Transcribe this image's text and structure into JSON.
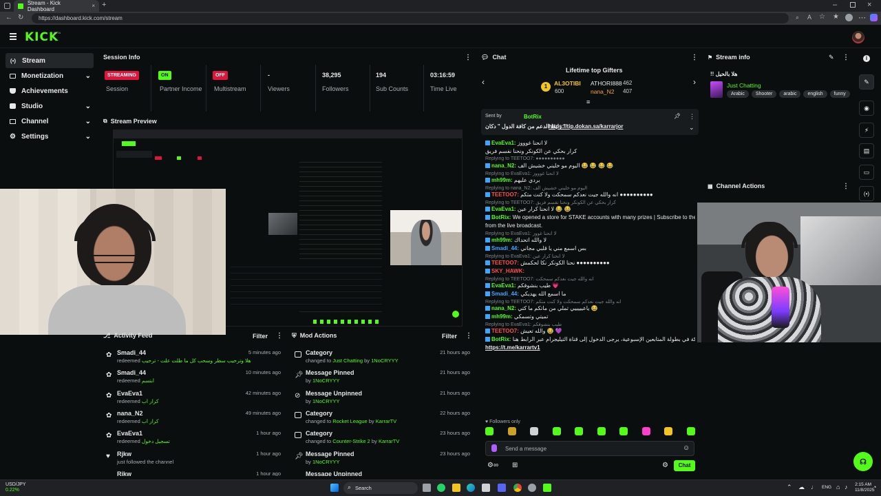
{
  "browser": {
    "tab_title": "Stream - Kick Dashboard",
    "url": "https://dashboard.kick.com/stream"
  },
  "brand": {
    "logo": "KICK",
    "beta": "BETA",
    "accent": "#53fc18"
  },
  "sidebar": {
    "items": [
      {
        "label": "Stream",
        "icon": "broadcast-icon"
      },
      {
        "label": "Monetization",
        "icon": "money-icon"
      },
      {
        "label": "Achievements",
        "icon": "trophy-icon"
      },
      {
        "label": "Studio",
        "icon": "studio-icon"
      },
      {
        "label": "Channel",
        "icon": "channel-icon"
      },
      {
        "label": "Settings",
        "icon": "gear-icon"
      }
    ]
  },
  "session": {
    "title": "Session Info",
    "stats": [
      {
        "badge": "STREAMING",
        "label": "Session"
      },
      {
        "badge": "ON",
        "label": "Partner Income"
      },
      {
        "badge": "OFF",
        "label": "Multistream"
      },
      {
        "value": "-",
        "label": "Viewers"
      },
      {
        "value": "38,295",
        "label": "Followers"
      },
      {
        "value": "194",
        "label": "Sub Counts"
      },
      {
        "value": "03:16:59",
        "label": "Time Live"
      }
    ]
  },
  "preview": {
    "title": "Stream Preview"
  },
  "activity": {
    "title": "Activity Feed",
    "filter": "Filter",
    "items": [
      {
        "name": "Smadi_44",
        "action": "redeemed",
        "reward": "هلا وترحيب سطر وسحب كل ما طلت علت - ترحيب",
        "time": "5 minutes ago"
      },
      {
        "name": "Smadi_44",
        "action": "redeemed",
        "reward": "ابتسم",
        "time": "10 minutes ago"
      },
      {
        "name": "EvaEva1",
        "action": "redeemed",
        "reward": "كرار اب",
        "time": "42 minutes ago"
      },
      {
        "name": "nana_N2",
        "action": "redeemed",
        "reward": "كرار اب",
        "time": "49 minutes ago"
      },
      {
        "name": "EvaEva1",
        "action": "redeemed",
        "reward": "تسجيل دخول",
        "time": "1 hour ago"
      },
      {
        "name": "Rjkw",
        "action": "just followed the channel",
        "reward": "",
        "time": "1 hour ago"
      },
      {
        "name": "Rjkw",
        "action": "",
        "reward": "",
        "time": "1 hour ago"
      }
    ]
  },
  "mod": {
    "title": "Mod Actions",
    "filter": "Filter",
    "items": [
      {
        "title": "Category",
        "prefix": "changed to",
        "target": "Just Chatting",
        "by": "by",
        "user": "1NoCRYYY",
        "time": "21 hours ago",
        "icon": "category-icon"
      },
      {
        "title": "Message Pinned",
        "prefix": "",
        "target": "",
        "by": "by",
        "user": "1NoCRYYY",
        "time": "21 hours ago",
        "icon": "pin-icon"
      },
      {
        "title": "Message Unpinned",
        "prefix": "",
        "target": "",
        "by": "by",
        "user": "1NoCRYYY",
        "time": "21 hours ago",
        "icon": "unpin-icon"
      },
      {
        "title": "Category",
        "prefix": "changed to",
        "target": "Rocket League",
        "by": "by",
        "user": "KarrarTV",
        "time": "22 hours ago",
        "icon": "category-icon"
      },
      {
        "title": "Category",
        "prefix": "changed to",
        "target": "Counter-Strike 2",
        "by": "by",
        "user": "KarrarTV",
        "time": "23 hours ago",
        "icon": "category-icon"
      },
      {
        "title": "Message Pinned",
        "prefix": "",
        "target": "",
        "by": "by",
        "user": "1NoCRYYY",
        "time": "23 hours ago",
        "icon": "pin-icon"
      },
      {
        "title": "Message Unpinned",
        "prefix": "",
        "target": "",
        "by": "",
        "user": "",
        "time": "",
        "icon": "unpin-icon"
      }
    ]
  },
  "chat": {
    "title": "Chat",
    "gifters_title": "Lifetime top Gifters",
    "gifters": [
      {
        "rank": "1",
        "name": "AL3OTIBI",
        "count": "600"
      },
      {
        "name": "ATHORI888",
        "count": "462"
      },
      {
        "name": "nana_N2",
        "count": "407"
      }
    ],
    "pinned": {
      "sent_by": "Sent by",
      "user": "BotRix",
      "text": "رابط الدعم من كافة الدول \" دكان \"",
      "link": "https://tip.dokan.sa/karrarjor"
    },
    "messages": [
      {
        "reply": "",
        "user": "EvaEva1:",
        "text": "لا انحنا غوووز",
        "color": "#53fc18"
      },
      {
        "reply": "",
        "user": "",
        "text": "كرار بحكي عن الكونكر ونحنا نفسم فريق",
        "color": "#e6e8ea"
      },
      {
        "reply": "Replying to TEETOO7: ●●●●●●●●●●",
        "user": "",
        "text": "",
        "color": "#7d8387"
      },
      {
        "reply": "",
        "user": "nana_N2:",
        "text": "اليوم مو خليني خشيش الف 😂 😂 😂 😂",
        "color": "#53fc18"
      },
      {
        "reply": "Replying to EvaEva1: لا انحنا غوووز",
        "user": "",
        "text": "",
        "color": "#7d8387"
      },
      {
        "reply": "",
        "user": "mh99m:",
        "text": "بردي عليهم",
        "color": "#53fc18"
      },
      {
        "reply": "Replying to nana_N2: اليوم مو خليني خشيش الف",
        "user": "",
        "text": "",
        "color": "#7d8387"
      },
      {
        "reply": "",
        "user": "TEETOO7:",
        "text": "انه والله جيت نعدكم سمحكت ولا كنت متكم ●●●●●●●●●●",
        "color": "#ff4d4d"
      },
      {
        "reply": "Replying to TEETOO7: كرار بحكي عن الكونكر ونحنا نفسم فريق",
        "user": "",
        "text": "",
        "color": "#7d8387"
      },
      {
        "reply": "",
        "user": "EvaEva1:",
        "text": "لا انحنا كرار عين 😂 😂",
        "color": "#53fc18"
      },
      {
        "reply": "",
        "user": "BotRix:",
        "text": "We opened a store for STAKE accounts with many prizes | Subscribe to the store and collect points",
        "color": "#53fc18"
      },
      {
        "reply": "",
        "user": "",
        "text": "from the live broadcast.",
        "color": "#e6e8ea"
      },
      {
        "reply": "Replying to EvaEva1: لا انحنا غووز",
        "user": "",
        "text": "",
        "color": "#7d8387"
      },
      {
        "reply": "",
        "user": "mh99m:",
        "text": "لا والله اتحداك",
        "color": "#53fc18"
      },
      {
        "reply": "",
        "user": "Smadi_44:",
        "text": "بس اسمع مني يا قلبي مجاني",
        "color": "#3ea6ff"
      },
      {
        "reply": "Replying to EvaEva1: لا انحنا كرار عين",
        "user": "",
        "text": "",
        "color": "#7d8387"
      },
      {
        "reply": "",
        "user": "TEETOO7:",
        "text": "نحنا الكونكر نكا لحكمش ●●●●●●●●●●",
        "color": "#ff4d4d"
      },
      {
        "reply": "",
        "user": "SKY_HAWK:",
        "text": "",
        "color": "#ff4d4d"
      },
      {
        "reply": "Replying to TEETOO7: انه والله جيت نعدكم سمحكت",
        "user": "",
        "text": "",
        "color": "#7d8387"
      },
      {
        "reply": "",
        "user": "EvaEva1:",
        "text": "طيب بنشوفكم 💗",
        "color": "#53fc18"
      },
      {
        "reply": "",
        "user": "Smadi_44:",
        "text": "ما اسمع الله يهديكي",
        "color": "#3ea6ff"
      },
      {
        "reply": "Replying to TEETOO7: انه والله جيت نعدكم سمحكت ولا كنت متكم",
        "user": "",
        "text": "",
        "color": "#7d8387"
      },
      {
        "reply": "",
        "user": "nana_N2:",
        "text": "ياعيييييي تملي من ماتكم ما كتي 😂",
        "color": "#53fc18"
      },
      {
        "reply": "",
        "user": "mh99m:",
        "text": "تميتي وتسمكي",
        "color": "#53fc18"
      },
      {
        "reply": "Replying to EvaEva1: طيب بنشوفكم",
        "user": "",
        "text": "",
        "color": "#7d8387"
      },
      {
        "reply": "",
        "user": "TEETOO7:",
        "text": "والله تعيش 😂 💜",
        "color": "#ff4d4d"
      },
      {
        "reply": "",
        "user": "BotRix:",
        "text": "للمشاركة في بطولة المتابعين الإسبوعية، يرجى الدخول إلى قناة التيليجرام عبر الرابط هنا ||",
        "color": "#53fc18"
      },
      {
        "reply": "",
        "user": "",
        "text": "https://t.me/karrartv1",
        "color": "#e6e8ea"
      }
    ],
    "followers_only": "Followers only",
    "input_placeholder": "Send a message",
    "send_label": "Chat"
  },
  "stream_info": {
    "title": "Stream info",
    "stream_title": "!! هلا بالحيل",
    "category": "Just Chatting",
    "tags": [
      "Arabic",
      "Shooter",
      "arabic",
      "english",
      "funny"
    ]
  },
  "channel_actions": {
    "title": "Channel Actions"
  },
  "taskbar": {
    "ticker": "USD/JPY",
    "ticker_change": "0.22%",
    "search": "Search",
    "lang": "ENG",
    "time": "2:15 AM",
    "date": "11/8/2025"
  }
}
